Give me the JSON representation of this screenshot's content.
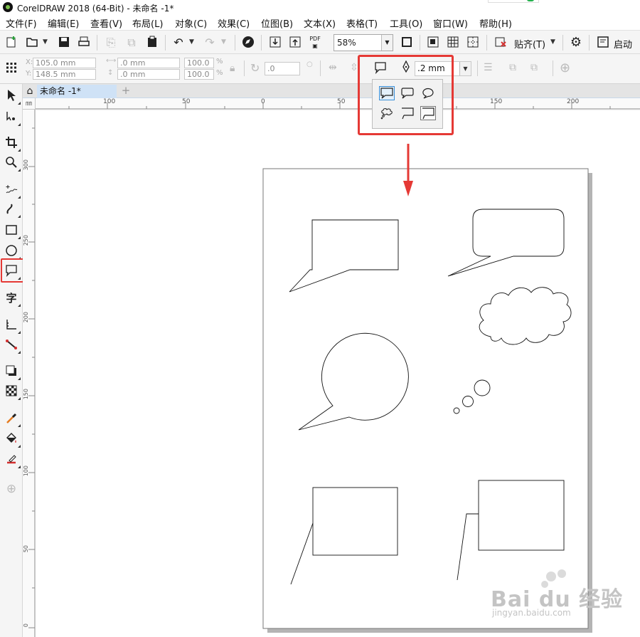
{
  "window": {
    "title": "CorelDRAW 2018 (64-Bit) - 未命名 -1*"
  },
  "menu": [
    "文件(F)",
    "编辑(E)",
    "查看(V)",
    "布局(L)",
    "对象(C)",
    "效果(C)",
    "位图(B)",
    "文本(X)",
    "表格(T)",
    "工具(O)",
    "窗口(W)",
    "帮助(H)"
  ],
  "toolbar": {
    "zoom_value": "58%",
    "pdf_label": "PDF",
    "snap_label": "贴齐(T)",
    "launch_label": "启动"
  },
  "propbar": {
    "x_label": "X:",
    "x_value": "105.0 mm",
    "y_label": "Y:",
    "y_value": "148.5 mm",
    "w_value": ".0 mm",
    "h_value": ".0 mm",
    "scale_w": "100.0",
    "scale_h": "100.0",
    "percent": "%",
    "rotation": ".0",
    "outline_width": ".2 mm"
  },
  "document": {
    "tab_label": "未命名 -1*"
  },
  "ruler": {
    "horizontal_ticks": [
      "100",
      "50",
      "0",
      "50",
      "100",
      "150",
      "200"
    ],
    "vertical_ticks": [
      "300",
      "250",
      "200",
      "150",
      "100",
      "50",
      "0"
    ],
    "corner_label": "㎜"
  },
  "toolbox": [
    "pick-tool",
    "shape-tool",
    "crop-tool",
    "zoom-tool",
    "freehand-tool",
    "artistic-media-tool",
    "rectangle-tool",
    "ellipse-tool",
    "callout-tool",
    "text-tool",
    "dimension-tool",
    "connector-tool",
    "drop-shadow-tool",
    "transparency-tool",
    "eyedropper-tool",
    "interactive-fill-tool",
    "smart-fill-tool",
    "add-tool"
  ],
  "callout_shapes": [
    "rectangle-callout",
    "speech-callout",
    "oval-callout",
    "thought-callout",
    "line-callout",
    "boxed-line-callout"
  ],
  "watermark": {
    "brand": "Bai du 经验",
    "url": "jingyan.baidu.com"
  },
  "colors": {
    "highlight": "#e53935",
    "active_tab": "#cfe2f6",
    "accent": "#3a8fd8"
  }
}
